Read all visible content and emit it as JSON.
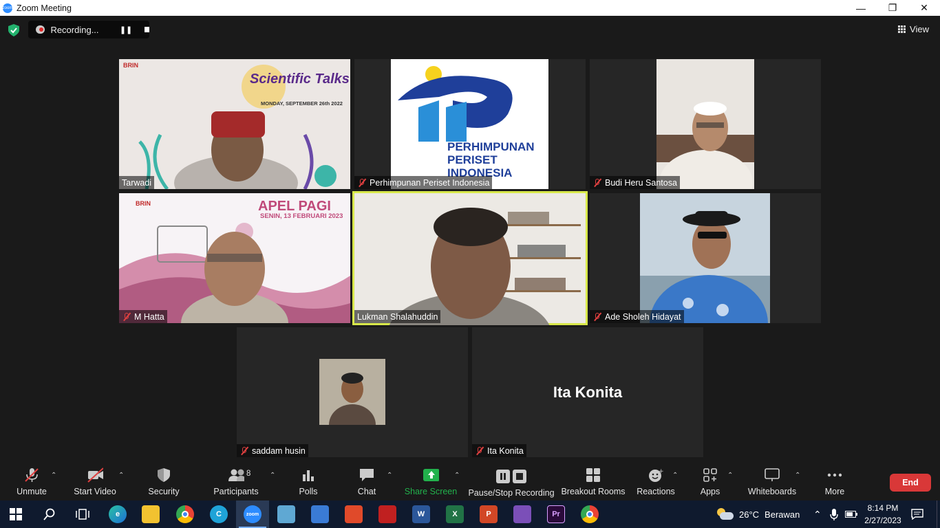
{
  "window": {
    "title": "Zoom Meeting"
  },
  "recording": {
    "label": "Recording..."
  },
  "view": {
    "label": "View"
  },
  "participants_tiles": [
    {
      "name": "Tarwadi",
      "banner_title": "Scientific Talks",
      "banner_date": "MONDAY, SEPTEMBER 26th 2022",
      "logo_text": "BRIN"
    },
    {
      "name": "Perhimpunan Periset Indonesia",
      "logo_line1": "PERHIMPUNAN",
      "logo_line2": "PERISET",
      "logo_line3": "INDONESIA"
    },
    {
      "name": "Budi Heru Santosa"
    },
    {
      "name": "M Hatta",
      "banner_title": "APEL PAGI",
      "banner_date": "SENIN, 13 FEBRUARI 2023",
      "logo_text": "BRIN"
    },
    {
      "name": "Lukman Shalahuddin"
    },
    {
      "name": "Ade Sholeh Hidayat"
    },
    {
      "name": "saddam husin"
    },
    {
      "name": "Ita Konita",
      "display_name": "Ita Konita"
    }
  ],
  "toolbar": {
    "unmute": "Unmute",
    "start_video": "Start Video",
    "security": "Security",
    "participants": "Participants",
    "participants_count": "8",
    "polls": "Polls",
    "chat": "Chat",
    "share_screen": "Share Screen",
    "pause_stop_recording": "Pause/Stop Recording",
    "breakout_rooms": "Breakout Rooms",
    "reactions": "Reactions",
    "apps": "Apps",
    "whiteboards": "Whiteboards",
    "more": "More",
    "end": "End"
  },
  "taskbar": {
    "weather_temp": "26°C",
    "weather_text": "Berawan",
    "time": "8:14 PM",
    "date": "2/27/2023"
  },
  "colors": {
    "active_speaker": "#d8e84a",
    "end_button": "#d93838",
    "share_green": "#22b14c",
    "muted_red": "#e04040"
  }
}
